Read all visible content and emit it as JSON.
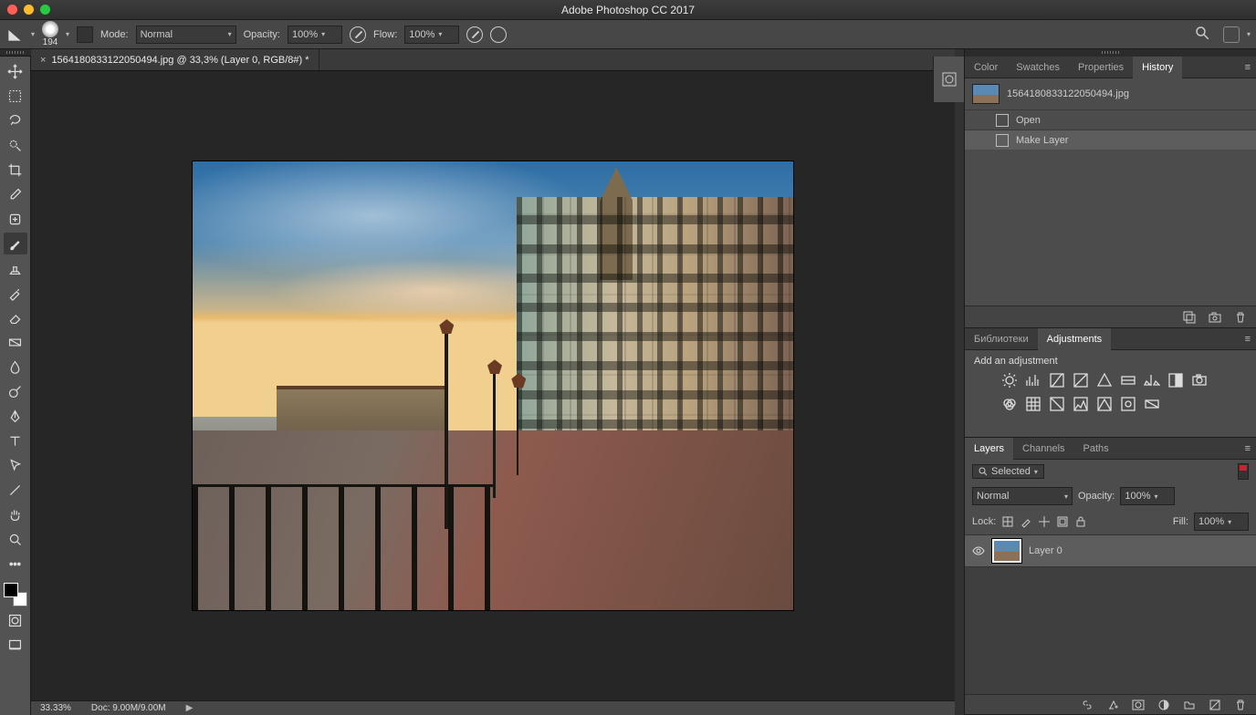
{
  "app_title": "Adobe Photoshop CC 2017",
  "options": {
    "brush_size": "194",
    "mode_label": "Mode:",
    "mode_value": "Normal",
    "opacity_label": "Opacity:",
    "opacity_value": "100%",
    "flow_label": "Flow:",
    "flow_value": "100%"
  },
  "document": {
    "tab_title": "15641808331220504​94.jpg @ 33,3% (Layer 0, RGB/8#) *"
  },
  "status": {
    "zoom": "33.33%",
    "doc": "Doc: 9.00M/9.00M"
  },
  "panels": {
    "top_tabs": [
      "Color",
      "Swatches",
      "Properties",
      "History"
    ],
    "top_active": 3,
    "history": {
      "snapshot_name": "15641808331220504​94.jpg",
      "states": [
        "Open",
        "Make Layer"
      ],
      "selected": 1
    },
    "mid_tabs": [
      "Библиотеки",
      "Adjustments"
    ],
    "mid_active": 1,
    "adjustments_hint": "Add an adjustment",
    "bottom_tabs": [
      "Layers",
      "Channels",
      "Paths"
    ],
    "bottom_active": 0,
    "layers": {
      "filter_label": "Selected",
      "blend_mode": "Normal",
      "opacity_label": "Opacity:",
      "opacity_value": "100%",
      "lock_label": "Lock:",
      "fill_label": "Fill:",
      "fill_value": "100%",
      "layer_name": "Layer 0"
    }
  }
}
